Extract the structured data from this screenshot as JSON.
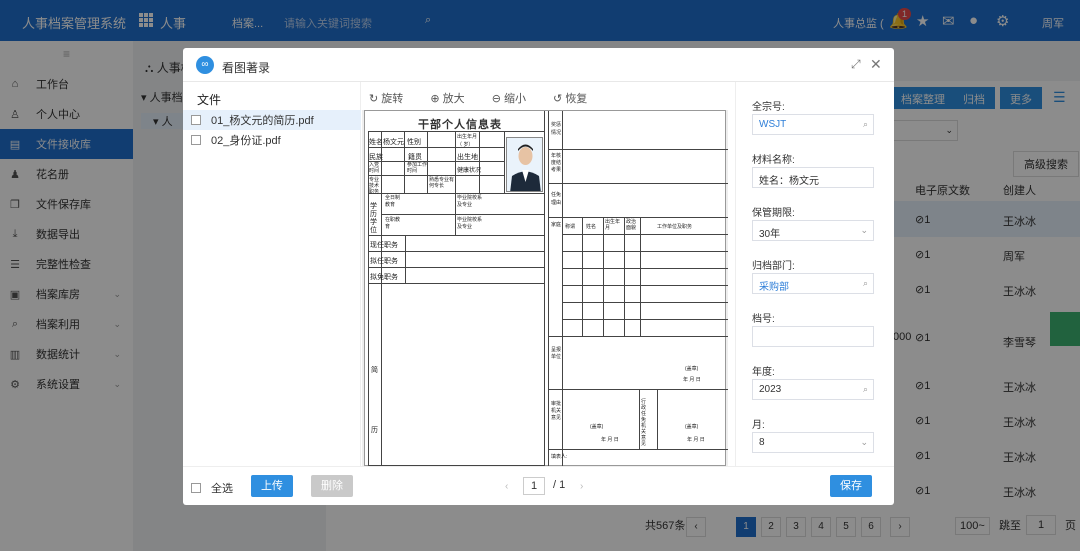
{
  "topbar": {
    "brand": "人事档案管理系统",
    "module": "人事",
    "search_scope": "档案...",
    "search_placeholder": "请输入关键词搜索",
    "user_role": "人事总监 (",
    "badge_count": "1",
    "user_name": "周军",
    "icons": [
      "grid-icon",
      "search-icon",
      "bell-icon",
      "star-icon",
      "mail-icon",
      "chat-icon",
      "settings-icon"
    ]
  },
  "sidebar": {
    "items": [
      {
        "label": "工作台",
        "icon": "home-icon"
      },
      {
        "label": "个人中心",
        "icon": "user-icon"
      },
      {
        "label": "文件接收库",
        "icon": "document-icon",
        "active": true
      },
      {
        "label": "花名册",
        "icon": "person-icon"
      },
      {
        "label": "文件保存库",
        "icon": "copy-icon"
      },
      {
        "label": "数据导出",
        "icon": "download-icon"
      },
      {
        "label": "完整性检查",
        "icon": "checklist-icon"
      },
      {
        "label": "档案库房",
        "icon": "warehouse-icon",
        "has_children": true
      },
      {
        "label": "档案利用",
        "icon": "search-icon",
        "has_children": true
      },
      {
        "label": "数据统计",
        "icon": "chart-icon",
        "has_children": true
      },
      {
        "label": "系统设置",
        "icon": "gear-icon",
        "has_children": true
      }
    ]
  },
  "background": {
    "tree_root": "人事档",
    "tree_child": "人",
    "buttons": [
      "档案整理",
      "归档",
      "更多"
    ],
    "adv_search": "高级搜索",
    "col_files": "电子原文数",
    "col_creator": "创建人",
    "rows": [
      {
        "count": "1",
        "creator": "王冰冰"
      },
      {
        "count": "1",
        "creator": "周军"
      },
      {
        "count": "1",
        "creator": "王冰冰"
      },
      {
        "count": "1",
        "creator": "李雪琴",
        "prefix": "000"
      },
      {
        "count": "1",
        "creator": "王冰冰"
      },
      {
        "count": "1",
        "creator": "王冰冰"
      },
      {
        "count": "1",
        "creator": "王冰冰"
      },
      {
        "count": "1",
        "creator": "王冰冰"
      }
    ],
    "pager": {
      "total": "共567条",
      "pages": [
        "1",
        "2",
        "3",
        "4",
        "5",
        "6"
      ],
      "current": "1",
      "page_size": "100~",
      "jump_label": "跳至",
      "jump_value": "1",
      "page_suffix": "页"
    }
  },
  "modal": {
    "title": "看图著录",
    "files_header": "文件",
    "files": [
      {
        "name": "01_杨文元的简历.pdf",
        "selected": true
      },
      {
        "name": "02_身份证.pdf",
        "selected": false
      }
    ],
    "tools": [
      "旋转",
      "放大",
      "缩小",
      "恢复"
    ],
    "document": {
      "title": "干部个人信息表",
      "field_name_label": "姓名",
      "field_name_value": "杨文元",
      "field_gender": "性别",
      "field_birth": "出生年月（  岁）",
      "field_ethnic": "民族",
      "field_origin": "籍贯",
      "field_birthplace": "出生地",
      "field_party": "入党时间",
      "field_work": "参加工作时间",
      "field_health": "健康状况",
      "field_title": "专业技术职务",
      "field_specialty": "熟悉专业有何专长",
      "field_edu": "学历学位",
      "field_fulltime": "全日制教育",
      "field_parttime": "在职教育",
      "field_school1": "毕业院校系及专业",
      "field_school2": "毕业院校系及专业",
      "field_current": "现任职务",
      "field_proposed": "拟任职务",
      "field_remove": "拟免职务",
      "field_resume": "简历",
      "field_reward": "奖惩情况",
      "field_annual": "年核度结考果",
      "field_reason": "任免理由",
      "field_family": "家庭",
      "family_cols": [
        "称谓",
        "姓名",
        "出生年月",
        "政治面貌",
        "工作单位及职务"
      ],
      "field_report_unit": "呈报单位",
      "field_review": "审批机关意见",
      "field_appoint": "行政任免机关意见",
      "seal": "(盖章)",
      "date": "年  月  日",
      "filler": "填表人:"
    },
    "props": {
      "fonds_label": "全宗号:",
      "fonds_value": "WSJT",
      "material_label": "材料名称:",
      "material_value": "姓名：杨文元",
      "retention_label": "保管期限:",
      "retention_value": "30年",
      "dept_label": "归档部门:",
      "dept_value": "采购部",
      "archive_no_label": "档号:",
      "archive_no_value": "",
      "year_label": "年度:",
      "year_value": "2023",
      "month_label": "月:",
      "month_value": "8"
    },
    "footer": {
      "select_all": "全选",
      "upload": "上传",
      "delete": "删除",
      "page_current": "1",
      "page_total": "/ 1",
      "save": "保存"
    }
  }
}
